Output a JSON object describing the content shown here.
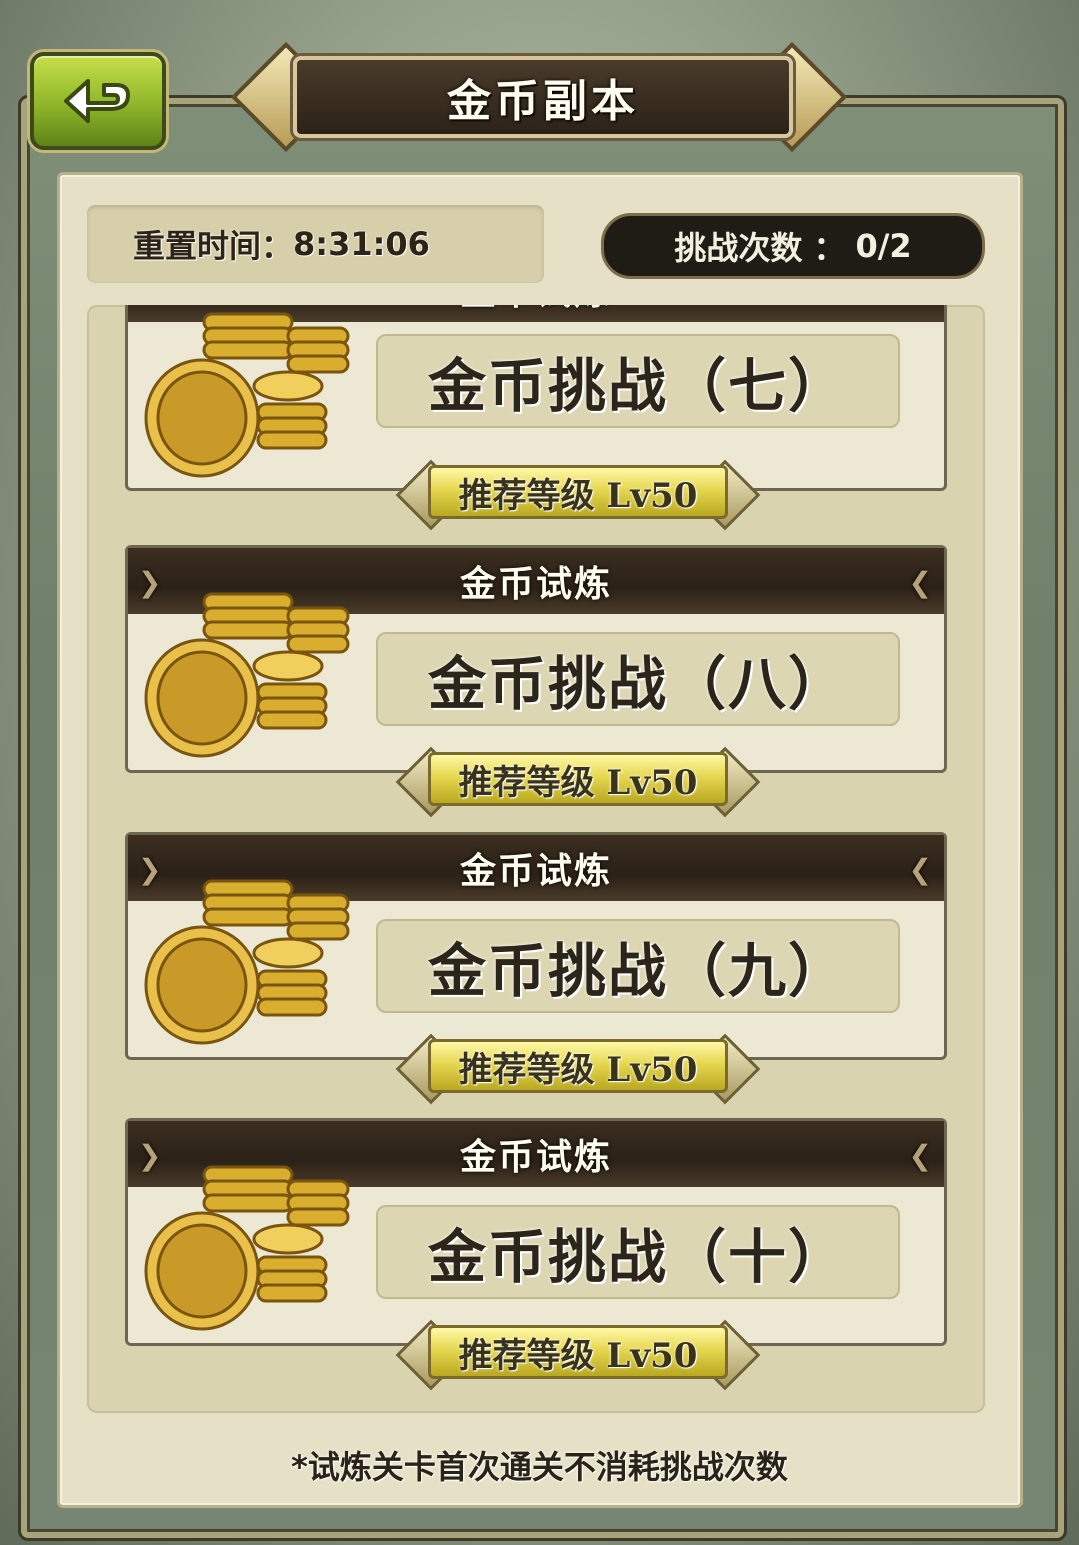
{
  "header": {
    "title": "金币副本"
  },
  "back_button": {
    "icon": "back-arrow-icon",
    "accent": "#8fb52a"
  },
  "info": {
    "reset_label": "重置时间：",
    "reset_time": "8:31:06",
    "challenge_label": "挑战次数 ：",
    "challenge_count": "0/2"
  },
  "stages": [
    {
      "category": "金币试炼",
      "name": "金币挑战（七）",
      "level": "推荐等级 Lv50",
      "icon": "gold-coins-icon"
    },
    {
      "category": "金币试炼",
      "name": "金币挑战（八）",
      "level": "推荐等级 Lv50",
      "icon": "gold-coins-icon"
    },
    {
      "category": "金币试炼",
      "name": "金币挑战（九）",
      "level": "推荐等级 Lv50",
      "icon": "gold-coins-icon"
    },
    {
      "category": "金币试炼",
      "name": "金币挑战（十）",
      "level": "推荐等级 Lv50",
      "icon": "gold-coins-icon"
    }
  ],
  "footer": {
    "note": "*试炼关卡首次通关不消耗挑战次数"
  }
}
